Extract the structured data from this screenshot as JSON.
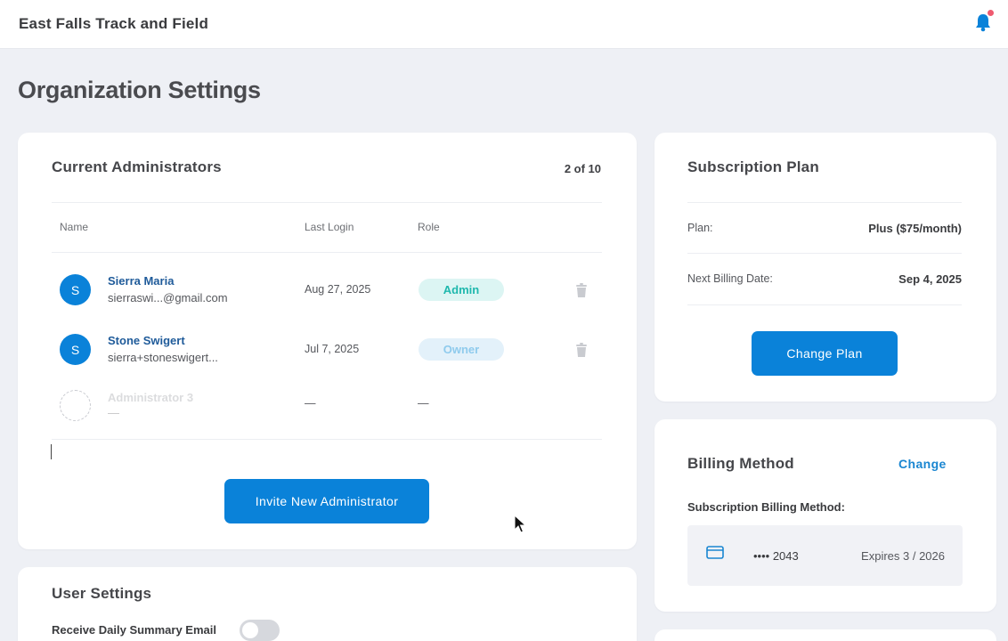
{
  "app": {
    "title": "East Falls Track and Field"
  },
  "page": {
    "title": "Organization Settings"
  },
  "admins": {
    "title": "Current Administrators",
    "count": "2 of 10",
    "columns": {
      "name": "Name",
      "last_login": "Last Login",
      "role": "Role"
    },
    "rows": [
      {
        "initial": "S",
        "name": "Sierra Maria",
        "email": "sierraswi...@gmail.com",
        "last_login": "Aug 27, 2025",
        "role": "Admin"
      },
      {
        "initial": "S",
        "name": "Stone Swigert",
        "email": "sierra+stoneswigert...",
        "last_login": "Jul 7, 2025",
        "role": "Owner"
      },
      {
        "initial": "",
        "name": "Administrator 3",
        "email": "—",
        "last_login": "—",
        "role": "—"
      }
    ],
    "invite_label": "Invite New Administrator"
  },
  "user_settings": {
    "title": "User Settings",
    "daily_email_label": "Receive Daily Summary Email",
    "daily_email_enabled": false
  },
  "subscription": {
    "title": "Subscription Plan",
    "plan_label": "Plan:",
    "plan_value": "Plus ($75/month)",
    "next_billing_label": "Next Billing Date:",
    "next_billing_value": "Sep 4, 2025",
    "change_plan_label": "Change Plan"
  },
  "billing": {
    "title": "Billing Method",
    "change_label": "Change",
    "method_label": "Subscription Billing Method:",
    "card_number": "•••• 2043",
    "expires": "Expires 3 / 2026"
  },
  "colors": {
    "primary": "#0a82d9",
    "admin_badge": "#1fb8ad",
    "owner_badge": "#8fcbed",
    "notification_dot": "#ef5a6f"
  }
}
